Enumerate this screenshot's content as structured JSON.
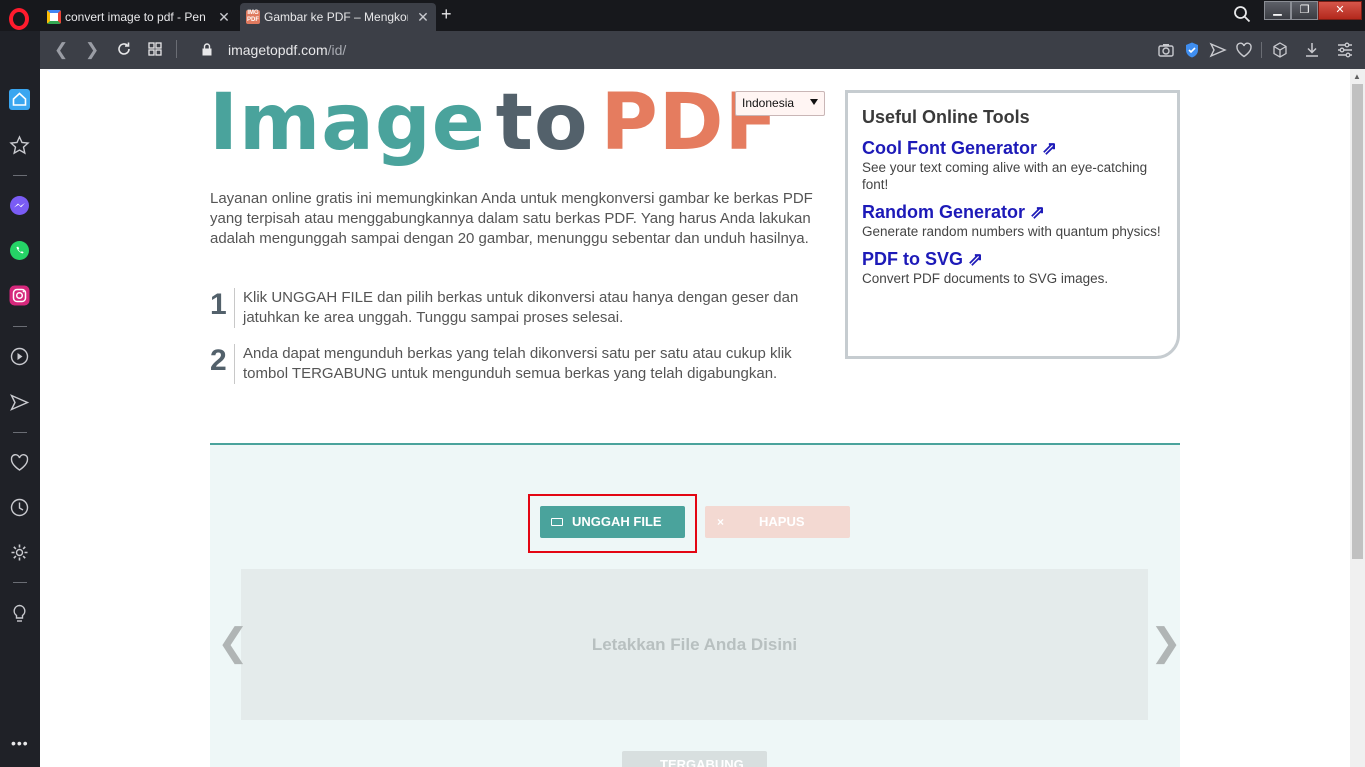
{
  "browser": {
    "tabs": [
      {
        "title": "convert image to pdf - Pen",
        "favicon": "google-icon",
        "active": false
      },
      {
        "title": "Gambar ke PDF – Mengkon",
        "favicon": "imagetopdf-icon",
        "favicon_text": "IMG PDF",
        "active": true
      }
    ],
    "new_tab_label": "+",
    "window_controls": {
      "minimize": "▁",
      "maximize": "❐",
      "close": "✕"
    },
    "url": {
      "host": "imagetopdf.com",
      "path": "/id/"
    }
  },
  "site": {
    "logo": {
      "image": "Image",
      "to_t": "t",
      "to_o": "o",
      "pdf": "PDF"
    },
    "language": {
      "selected": "Indonesia"
    },
    "intro": "Layanan online gratis ini memungkinkan Anda untuk mengkonversi gambar ke berkas PDF yang terpisah atau menggabungkannya dalam satu berkas PDF. Yang harus Anda lakukan adalah mengunggah sampai dengan 20 gambar, menunggu sebentar dan unduh hasilnya.",
    "steps": [
      {
        "num": "1",
        "text": "Klik UNGGAH FILE dan pilih berkas untuk dikonversi atau hanya dengan geser dan jatuhkan ke area unggah. Tunggu sampai proses selesai."
      },
      {
        "num": "2",
        "text": "Anda dapat mengunduh berkas yang telah dikonversi satu per satu atau cukup klik tombol TERGABUNG untuk mengunduh semua berkas yang telah digabungkan."
      }
    ],
    "tools": {
      "title": "Useful Online Tools",
      "items": [
        {
          "name": "Cool Font Generator ⇗",
          "desc": "See your text coming alive with an eye-catching font!"
        },
        {
          "name": "Random Generator ⇗",
          "desc": "Generate random numbers with quantum physics!"
        },
        {
          "name": "PDF to SVG ⇗",
          "desc": "Convert PDF documents to SVG images."
        }
      ]
    },
    "upload": {
      "upload_button": "UNGGAH FILE",
      "clear_icon": "×",
      "clear_button": "HAPUS",
      "dropzone_text": "Letakkan File Anda Disini",
      "prev_arrow": "❮",
      "next_arrow": "❯",
      "combine_button": "TERGABUNG"
    }
  },
  "colors": {
    "teal": "#4aa39c",
    "slate": "#53616b",
    "coral": "#e57c5f",
    "link": "#1d1ab8",
    "highlight": "#e30613"
  }
}
